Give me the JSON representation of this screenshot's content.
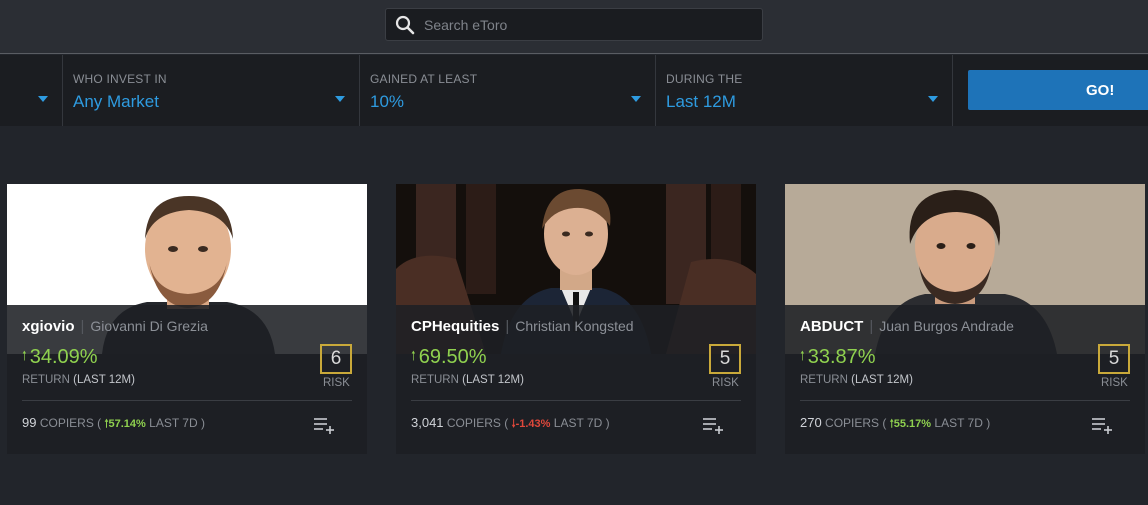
{
  "search": {
    "placeholder": "Search eToro"
  },
  "filters": [
    {
      "label": "WHO INVEST IN",
      "value": "Any Market"
    },
    {
      "label": "GAINED AT LEAST",
      "value": "10%"
    },
    {
      "label": "DURING THE",
      "value": "Last 12M"
    }
  ],
  "go_label": "GO!",
  "cards": [
    {
      "username": "xgiovio",
      "full_name": "Giovanni Di Grezia",
      "return": "34.09%",
      "return_label": "RETURN",
      "return_period": "(LAST 12M)",
      "risk": "6",
      "risk_label": "RISK",
      "copiers": "99",
      "copiers_label": "COPIERS (",
      "copiers_change": "57.14%",
      "copiers_period": "LAST 7D )",
      "change_direction": "up"
    },
    {
      "username": "CPHequities",
      "full_name": "Christian Kongsted",
      "return": "69.50%",
      "return_label": "RETURN",
      "return_period": "(LAST 12M)",
      "risk": "5",
      "risk_label": "RISK",
      "copiers": "3,041",
      "copiers_label": "COPIERS (",
      "copiers_change": "-1.43%",
      "copiers_period": "LAST 7D )",
      "change_direction": "down"
    },
    {
      "username": "ABDUCT",
      "full_name": "Juan Burgos Andrade",
      "return": "33.87%",
      "return_label": "RETURN",
      "return_period": "(LAST 12M)",
      "risk": "5",
      "risk_label": "RISK",
      "copiers": "270",
      "copiers_label": "COPIERS (",
      "copiers_change": "55.17%",
      "copiers_period": "LAST 7D )",
      "change_direction": "up"
    }
  ],
  "colors": {
    "accent_blue": "#2e9be0",
    "go_button": "#1e73b8",
    "gain_green": "#8fd14f",
    "loss_red": "#e0483b",
    "risk_border": "#c9a93a"
  }
}
